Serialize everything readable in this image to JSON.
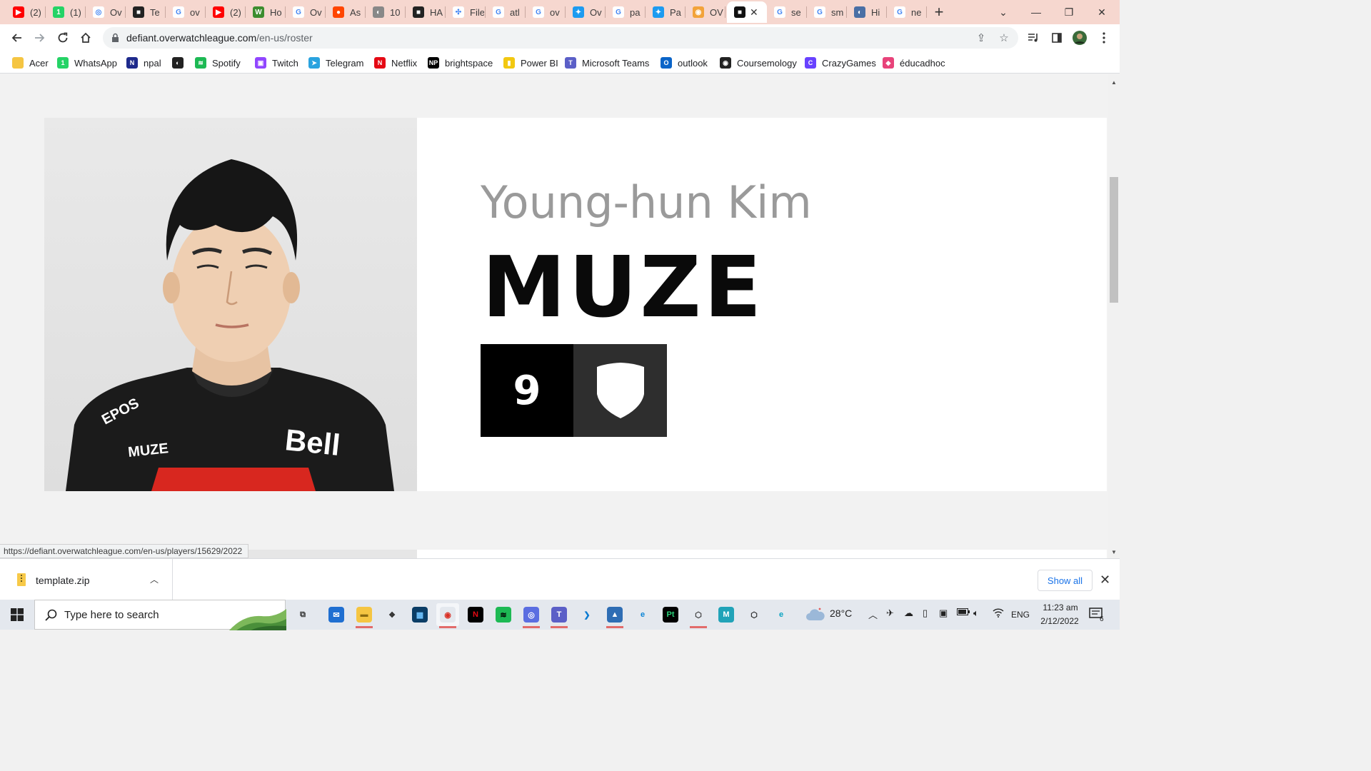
{
  "tabs": [
    {
      "title": "(2)",
      "fav": "youtube",
      "color": "#ff0000",
      "glyph": "▶"
    },
    {
      "title": "(1)",
      "fav": "whatsapp",
      "color": "#25d366",
      "glyph": "1"
    },
    {
      "title": "Ov",
      "fav": "overwatch",
      "color": "#ffffff",
      "glyph": "◎"
    },
    {
      "title": "Te",
      "fav": "team",
      "color": "#222222",
      "glyph": "■"
    },
    {
      "title": "ov",
      "fav": "google",
      "color": "#ffffff",
      "glyph": "G"
    },
    {
      "title": "(2)",
      "fav": "youtube",
      "color": "#ff0000",
      "glyph": "▶"
    },
    {
      "title": "Ho",
      "fav": "wikihow",
      "color": "#3c8d2f",
      "glyph": "W"
    },
    {
      "title": "Ov",
      "fav": "google",
      "color": "#ffffff",
      "glyph": "G"
    },
    {
      "title": "As",
      "fav": "reddit",
      "color": "#ff4500",
      "glyph": "●"
    },
    {
      "title": "10",
      "fav": "globe",
      "color": "#888888",
      "glyph": "◐"
    },
    {
      "title": "HA",
      "fav": "team",
      "color": "#222222",
      "glyph": "■"
    },
    {
      "title": "File",
      "fav": "files",
      "color": "#ffffff",
      "glyph": "✣"
    },
    {
      "title": "atl",
      "fav": "google",
      "color": "#ffffff",
      "glyph": "G"
    },
    {
      "title": "ov",
      "fav": "google",
      "color": "#ffffff",
      "glyph": "G"
    },
    {
      "title": "Ov",
      "fav": "twitter",
      "color": "#1d9bf0",
      "glyph": "✦"
    },
    {
      "title": "pa",
      "fav": "google",
      "color": "#ffffff",
      "glyph": "G"
    },
    {
      "title": "Pa",
      "fav": "twitter",
      "color": "#1d9bf0",
      "glyph": "✦"
    },
    {
      "title": "OV",
      "fav": "owl",
      "color": "#f2a33a",
      "glyph": "◉"
    },
    {
      "title": "",
      "fav": "defiant",
      "color": "#111111",
      "glyph": "■",
      "active": true
    },
    {
      "title": "se",
      "fav": "google",
      "color": "#ffffff",
      "glyph": "G"
    },
    {
      "title": "sm",
      "fav": "google",
      "color": "#ffffff",
      "glyph": "G"
    },
    {
      "title": "Hi",
      "fav": "globe",
      "color": "#4a6fa5",
      "glyph": "◐"
    },
    {
      "title": "ne",
      "fav": "google",
      "color": "#ffffff",
      "glyph": "G"
    }
  ],
  "toolbar": {
    "url_host": "defiant.overwatchleague.com",
    "url_path": "/en-us/roster"
  },
  "bookmarks": [
    {
      "label": "Acer",
      "icon": "folder-icon",
      "color": "#f5c542",
      "glyph": ""
    },
    {
      "label": "WhatsApp",
      "icon": "whatsapp-icon",
      "color": "#25d366",
      "glyph": "1"
    },
    {
      "label": "npal",
      "icon": "npal-icon",
      "color": "#1e2a8c",
      "glyph": "N"
    },
    {
      "label": "",
      "icon": "globe-icon",
      "color": "#222222",
      "glyph": "◐"
    },
    {
      "label": "Spotify",
      "icon": "spotify-icon",
      "color": "#1db954",
      "glyph": "≋"
    },
    {
      "label": "Twitch",
      "icon": "twitch-icon",
      "color": "#9146ff",
      "glyph": "▣"
    },
    {
      "label": "Telegram",
      "icon": "telegram-icon",
      "color": "#2aa3df",
      "glyph": "➤"
    },
    {
      "label": "Netflix",
      "icon": "netflix-icon",
      "color": "#e50914",
      "glyph": "N"
    },
    {
      "label": "brightspace",
      "icon": "np-icon",
      "color": "#000000",
      "glyph": "NP"
    },
    {
      "label": "Power BI",
      "icon": "powerbi-icon",
      "color": "#f2c811",
      "glyph": "▮"
    },
    {
      "label": "Microsoft Teams",
      "icon": "teams-icon",
      "color": "#5b5fc7",
      "glyph": "T"
    },
    {
      "label": "outlook",
      "icon": "outlook-icon",
      "color": "#0a64c8",
      "glyph": "O"
    },
    {
      "label": "Coursemology",
      "icon": "coursemology-icon",
      "color": "#222222",
      "glyph": "◉"
    },
    {
      "label": "CrazyGames",
      "icon": "crazygames-icon",
      "color": "#6842ff",
      "glyph": "C"
    },
    {
      "label": "éducadhoc",
      "icon": "educadhoc-icon",
      "color": "#e8437a",
      "glyph": "◆"
    }
  ],
  "player": {
    "real_name": "Young-hun Kim",
    "handle": "MUZE",
    "number": "9",
    "role_icon": "support-shield-icon",
    "jersey_text_name": "MUZE",
    "jersey_sponsor": "Bell",
    "jersey_brand": "EPOS"
  },
  "status_url": "https://defiant.overwatchleague.com/en-us/players/15629/2022",
  "downloads": {
    "file_name": "template.zip",
    "show_all_label": "Show all"
  },
  "taskbar": {
    "search_placeholder": "Type here to search",
    "weather": "28°C",
    "language": "ENG",
    "time": "11:23 am",
    "date": "2/12/2022",
    "notification_count": "6",
    "apps": [
      {
        "name": "task-view",
        "color": "#e4e8ee",
        "glyph": "⧉",
        "fg": "#333"
      },
      {
        "name": "mail",
        "color": "#1f6fd1",
        "glyph": "✉",
        "fg": "#fff"
      },
      {
        "name": "file-explorer",
        "color": "#f5c542",
        "glyph": "▬",
        "fg": "#8a6a10"
      },
      {
        "name": "dropbox",
        "color": "#e4e8ee",
        "glyph": "❖",
        "fg": "#333"
      },
      {
        "name": "store",
        "color": "#0b3d66",
        "glyph": "▦",
        "fg": "#6fc3ff"
      },
      {
        "name": "chrome",
        "color": "#e4e8ee",
        "glyph": "◉",
        "fg": "#d93025",
        "active": true
      },
      {
        "name": "netflix",
        "color": "#000000",
        "glyph": "N",
        "fg": "#e50914"
      },
      {
        "name": "spotify",
        "color": "#1db954",
        "glyph": "≋",
        "fg": "#000"
      },
      {
        "name": "chrome-profile",
        "color": "#5b6ee1",
        "glyph": "◎",
        "fg": "#fff"
      },
      {
        "name": "teams",
        "color": "#5b5fc7",
        "glyph": "T",
        "fg": "#fff"
      },
      {
        "name": "vscode",
        "color": "#e4e8ee",
        "glyph": "❯",
        "fg": "#0a7ad1"
      },
      {
        "name": "photos",
        "color": "#2e6db4",
        "glyph": "▲",
        "fg": "#fff"
      },
      {
        "name": "edge",
        "color": "#e4e8ee",
        "glyph": "e",
        "fg": "#0a84d6"
      },
      {
        "name": "pycharm",
        "color": "#000000",
        "glyph": "Pt",
        "fg": "#29d17a"
      },
      {
        "name": "unity",
        "color": "#e4e8ee",
        "glyph": "⬡",
        "fg": "#333"
      },
      {
        "name": "maya",
        "color": "#21a3b8",
        "glyph": "M",
        "fg": "#fff"
      },
      {
        "name": "unity-hub",
        "color": "#e4e8ee",
        "glyph": "⬡",
        "fg": "#222"
      },
      {
        "name": "edge-dev",
        "color": "#e4e8ee",
        "glyph": "e",
        "fg": "#0aa3c2"
      }
    ]
  }
}
